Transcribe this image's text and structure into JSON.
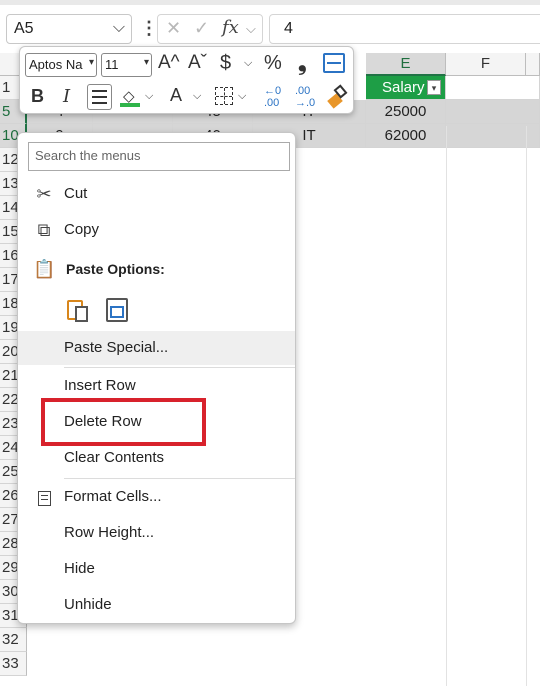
{
  "formula_bar": {
    "name_box": "A5",
    "cancel_glyph": "✕",
    "confirm_glyph": "✓",
    "fx_label": "fx",
    "value": "4"
  },
  "columns": [
    {
      "label": "E"
    },
    {
      "label": "F"
    }
  ],
  "rows": [
    "1",
    "5",
    "10",
    "12",
    "13",
    "14",
    "15",
    "16",
    "17",
    "18",
    "19",
    "20",
    "21",
    "22",
    "23",
    "24",
    "25",
    "26",
    "27",
    "28",
    "29",
    "30",
    "31",
    "32",
    "33"
  ],
  "table": {
    "salary_header": "Salary",
    "row5": {
      "col_a": "4",
      "col_c": "45",
      "dept": "IT",
      "salary": "25000"
    },
    "row10": {
      "col_a": "9",
      "col_c": "40",
      "dept": "IT",
      "salary": "62000"
    }
  },
  "mini_toolbar": {
    "font_name": "Aptos Na",
    "font_size": "11",
    "grow_font": "A^",
    "shrink_font": "Aˇ",
    "currency": "$",
    "percent": "%",
    "comma": "❟",
    "bold": "B",
    "italic": "I",
    "font_color": "A",
    "inc_decimal_top": "←0",
    "inc_decimal_bottom": ".00",
    "dec_decimal_top": ".00",
    "dec_decimal_bottom": "→.0"
  },
  "context_menu": {
    "search_placeholder": "Search the menus",
    "items": {
      "cut": "Cut",
      "copy": "Copy",
      "paste_options": "Paste Options:",
      "paste_special": "Paste Special...",
      "insert_row": "Insert Row",
      "delete_row": "Delete Row",
      "clear_contents": "Clear Contents",
      "format_cells": "Format Cells...",
      "row_height": "Row Height...",
      "hide": "Hide",
      "unhide": "Unhide"
    }
  },
  "colors": {
    "table_header_green": "#1e9e46",
    "highlight_red": "#d8222c",
    "fill_color_green": "#2fb44a",
    "font_color_red": "#e03030"
  },
  "icons": [
    "chevron-down-icon",
    "cancel-icon",
    "confirm-icon",
    "fx-icon",
    "scissors-icon",
    "copy-icon",
    "paste-icon",
    "paste-keep-icon",
    "paste-picture-icon",
    "format-cells-icon",
    "wrap-text-icon",
    "format-painter-icon",
    "borders-icon",
    "fill-color-icon",
    "align-center-icon"
  ]
}
